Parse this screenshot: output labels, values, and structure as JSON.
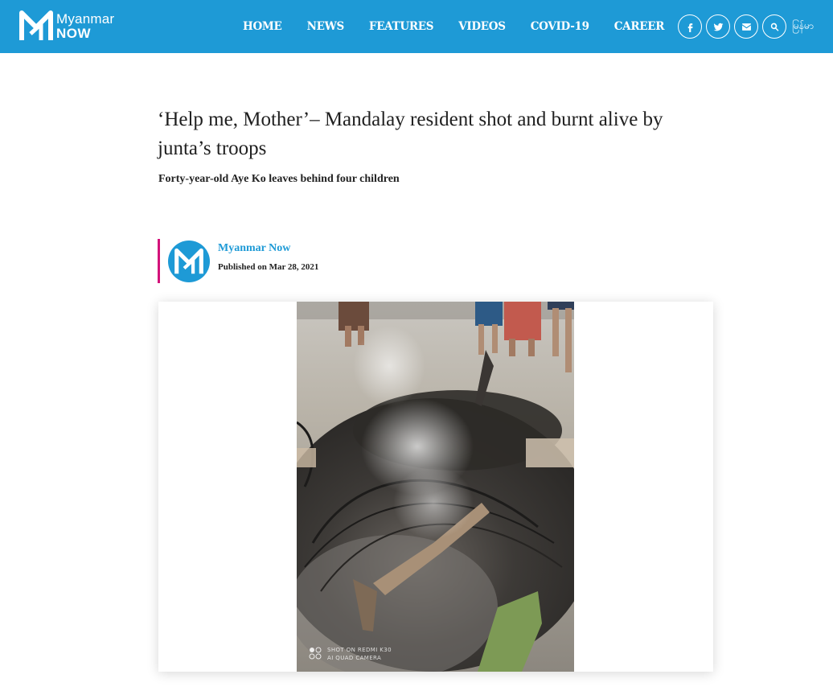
{
  "brand": {
    "line1": "Myanmar",
    "line2": "NOW"
  },
  "nav": [
    {
      "label": "HOME"
    },
    {
      "label": "NEWS"
    },
    {
      "label": "FEATURES"
    },
    {
      "label": "VIDEOS"
    },
    {
      "label": "COVID-19"
    },
    {
      "label": "CAREER"
    }
  ],
  "header_icons": [
    "facebook-icon",
    "twitter-icon",
    "email-icon",
    "search-icon"
  ],
  "language_label": "မြန်မာ",
  "article": {
    "title": "‘Help me, Mother’– Mandalay resident shot and burnt alive by junta’s troops",
    "subtitle": "Forty-year-old Aye Ko leaves behind four children",
    "author": "Myanmar Now",
    "published": "Published on Mar 28, 2021",
    "photo_watermark_line1": "SHOT ON REDMI K30",
    "photo_watermark_line2": "AI QUAD CAMERA"
  },
  "colors": {
    "brand_blue": "#1e9ad6",
    "accent_magenta": "#d3137a"
  }
}
